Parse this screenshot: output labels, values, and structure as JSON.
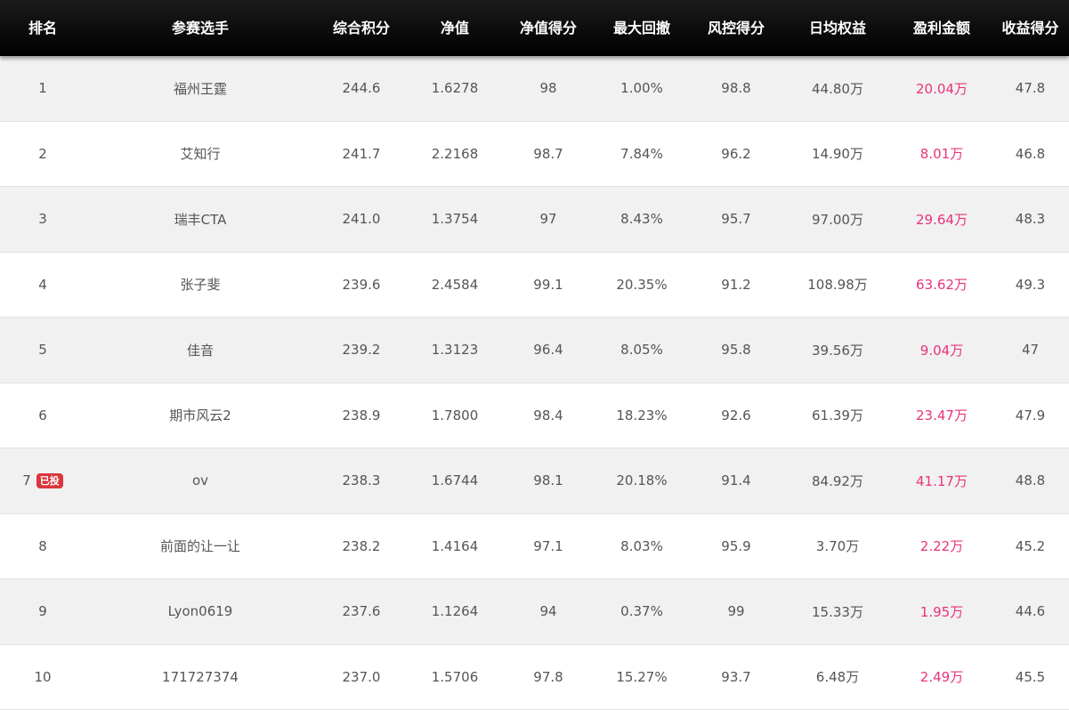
{
  "headers": {
    "rank": "排名",
    "player": "参赛选手",
    "total_score": "综合积分",
    "nav": "净值",
    "nav_score": "净值得分",
    "max_drawdown": "最大回撤",
    "risk_score": "风控得分",
    "daily_equity": "日均权益",
    "profit": "盈利金额",
    "return_score": "收益得分"
  },
  "rows": [
    {
      "rank": "1",
      "badge": "",
      "player": "福州王霆",
      "total_score": "244.6",
      "nav": "1.6278",
      "nav_score": "98",
      "max_drawdown": "1.00%",
      "risk_score": "98.8",
      "daily_equity": "44.80万",
      "profit": "20.04万",
      "return_score": "47.8"
    },
    {
      "rank": "2",
      "badge": "",
      "player": "艾知行",
      "total_score": "241.7",
      "nav": "2.2168",
      "nav_score": "98.7",
      "max_drawdown": "7.84%",
      "risk_score": "96.2",
      "daily_equity": "14.90万",
      "profit": "8.01万",
      "return_score": "46.8"
    },
    {
      "rank": "3",
      "badge": "",
      "player": "瑞丰CTA",
      "total_score": "241.0",
      "nav": "1.3754",
      "nav_score": "97",
      "max_drawdown": "8.43%",
      "risk_score": "95.7",
      "daily_equity": "97.00万",
      "profit": "29.64万",
      "return_score": "48.3"
    },
    {
      "rank": "4",
      "badge": "",
      "player": "张子斐",
      "total_score": "239.6",
      "nav": "2.4584",
      "nav_score": "99.1",
      "max_drawdown": "20.35%",
      "risk_score": "91.2",
      "daily_equity": "108.98万",
      "profit": "63.62万",
      "return_score": "49.3"
    },
    {
      "rank": "5",
      "badge": "",
      "player": "佳音",
      "total_score": "239.2",
      "nav": "1.3123",
      "nav_score": "96.4",
      "max_drawdown": "8.05%",
      "risk_score": "95.8",
      "daily_equity": "39.56万",
      "profit": "9.04万",
      "return_score": "47"
    },
    {
      "rank": "6",
      "badge": "",
      "player": "期市风云2",
      "total_score": "238.9",
      "nav": "1.7800",
      "nav_score": "98.4",
      "max_drawdown": "18.23%",
      "risk_score": "92.6",
      "daily_equity": "61.39万",
      "profit": "23.47万",
      "return_score": "47.9"
    },
    {
      "rank": "7",
      "badge": "已投",
      "player": "ov",
      "total_score": "238.3",
      "nav": "1.6744",
      "nav_score": "98.1",
      "max_drawdown": "20.18%",
      "risk_score": "91.4",
      "daily_equity": "84.92万",
      "profit": "41.17万",
      "return_score": "48.8"
    },
    {
      "rank": "8",
      "badge": "",
      "player": "前面的让一让",
      "total_score": "238.2",
      "nav": "1.4164",
      "nav_score": "97.1",
      "max_drawdown": "8.03%",
      "risk_score": "95.9",
      "daily_equity": "3.70万",
      "profit": "2.22万",
      "return_score": "45.2"
    },
    {
      "rank": "9",
      "badge": "",
      "player": "Lyon0619",
      "total_score": "237.6",
      "nav": "1.1264",
      "nav_score": "94",
      "max_drawdown": "0.37%",
      "risk_score": "99",
      "daily_equity": "15.33万",
      "profit": "1.95万",
      "return_score": "44.6"
    },
    {
      "rank": "10",
      "badge": "",
      "player": "171727374",
      "total_score": "237.0",
      "nav": "1.5706",
      "nav_score": "97.8",
      "max_drawdown": "15.27%",
      "risk_score": "93.7",
      "daily_equity": "6.48万",
      "profit": "2.49万",
      "return_score": "45.5"
    }
  ],
  "colors": {
    "header_bg": "#000000",
    "header_text": "#ffffff",
    "profit_text": "#e8337a",
    "badge_bg": "#d9363e",
    "row_alt_bg": "#f1f1f1"
  }
}
